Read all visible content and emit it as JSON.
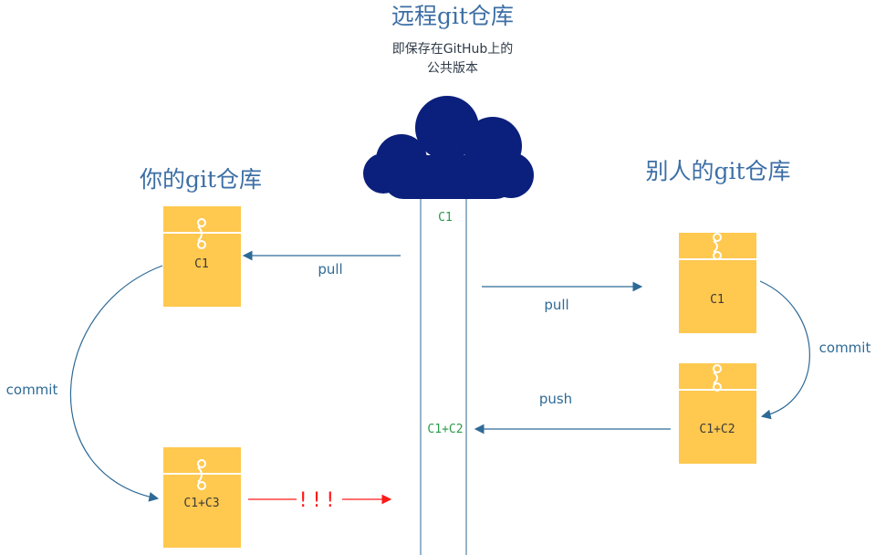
{
  "remote": {
    "title": "远程git仓库",
    "subtitle_line1": "即保存在GitHub上的",
    "subtitle_line2": "公共版本",
    "commit_top": "C1",
    "commit_bottom": "C1+C2"
  },
  "yours": {
    "title": "你的git仓库",
    "folder_top_label": "C1",
    "folder_bottom_label": "C1+C3",
    "arrow_label": "commit",
    "pull_label": "pull",
    "warning": "!!!"
  },
  "others": {
    "title": "别人的git仓库",
    "folder_top_label": "C1",
    "folder_bottom_label": "C1+C2",
    "arrow_label": "commit",
    "pull_label": "pull",
    "push_label": "push"
  },
  "colors": {
    "cloud": "#0b1f7c",
    "folder_fill": "#ffc84f",
    "arrow": "#2e6a96",
    "commit_text": "#2a9a4a",
    "warning": "#ff1a1a"
  }
}
